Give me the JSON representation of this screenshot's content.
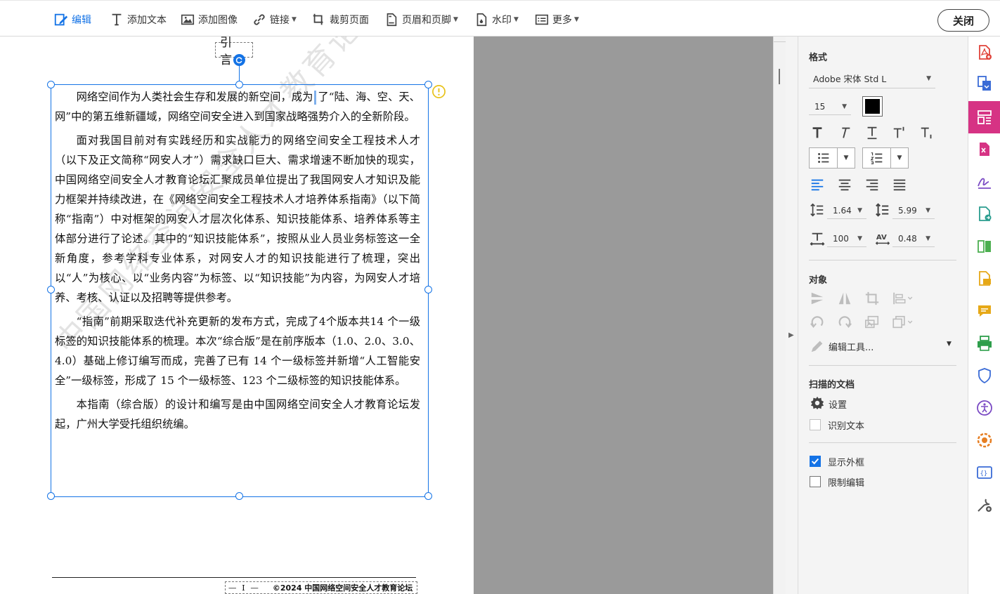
{
  "toolbar": {
    "edit": "编辑",
    "add_text": "添加文本",
    "add_image": "添加图像",
    "link": "链接",
    "crop": "裁剪页面",
    "header_footer": "页眉和页脚",
    "watermark": "水印",
    "more": "更多",
    "close": "关闭"
  },
  "document": {
    "title": "引 言",
    "paragraphs": [
      {
        "before": "网络空间作为人类社会生存和发展的新空间，成为",
        "after": "了“陆、海、空、天、网”中的第五维新疆域，网络空间安全进入到国家战略强势介入的全新阶段。"
      },
      {
        "before": "面对我国目前对有实践经历和实战能力的网络空间安全工程技术人才（以下及正文简称“网安人才”）需求缺口巨大、需求增速不断加快的现实，中国网络空间安全人才教育论坛汇聚成员单位提出了我国网安人才知识及能力框架并持续改进，在《网络空间安全工程技术人才培养体系指南》（以下简称“指南”）中对框架的网安人才层次化体系、知识技能体系、培养体系等主体部分进行了论述。其中的“知识技能体系”，按照从业人员业务标签这一全新角度，参考学科专业体系，对网安人才的知识技能进行了梳理，突出以“人”为核心、以“业务内容”为标签、以“知识技能”为内容，为网安人才培养、考核、认证以及招聘等提供参考。",
        "after": ""
      },
      {
        "before": "“指南”前期采取迭代补充更新的发布方式，完成了4个版本共14 个一级标签的知识技能体系的梳理。本次“综合版”是在前序版本（1.0、2.0、3.0、4.0）基础上修订编写而成，完善了已有 14 个一级标签并新增“人工智能安全”一级标签，形成了 15 个一级标签、123 个二级标签的知识技能体系。",
        "after": ""
      },
      {
        "before": "本指南（综合版）的设计和编写是由中国网络空间安全人才教育论坛发起，广州大学受托组织统编。",
        "after": ""
      }
    ],
    "watermark": "中国网络空间安全人才教育论坛",
    "footer_page": "— Ⅰ —",
    "footer_copyright": "©2024 中国网络空间安全人才教育论坛"
  },
  "panel": {
    "format_label": "格式",
    "font_name": "Adobe 宋体 Std L",
    "font_size": "15",
    "text_color": "#000000",
    "line_spacing": "1.64",
    "para_spacing": "5.99",
    "horiz_scale": "100",
    "char_spacing": "0.48",
    "object_label": "对象",
    "edit_tools": "编辑工具...",
    "scanned_label": "扫描的文档",
    "settings": "设置",
    "recognize_text": "识别文本",
    "show_bbox": "显示外框",
    "restrict_edit": "限制编辑"
  },
  "colors": {
    "accent": "#1473e6",
    "rail_active": "#d63384"
  }
}
